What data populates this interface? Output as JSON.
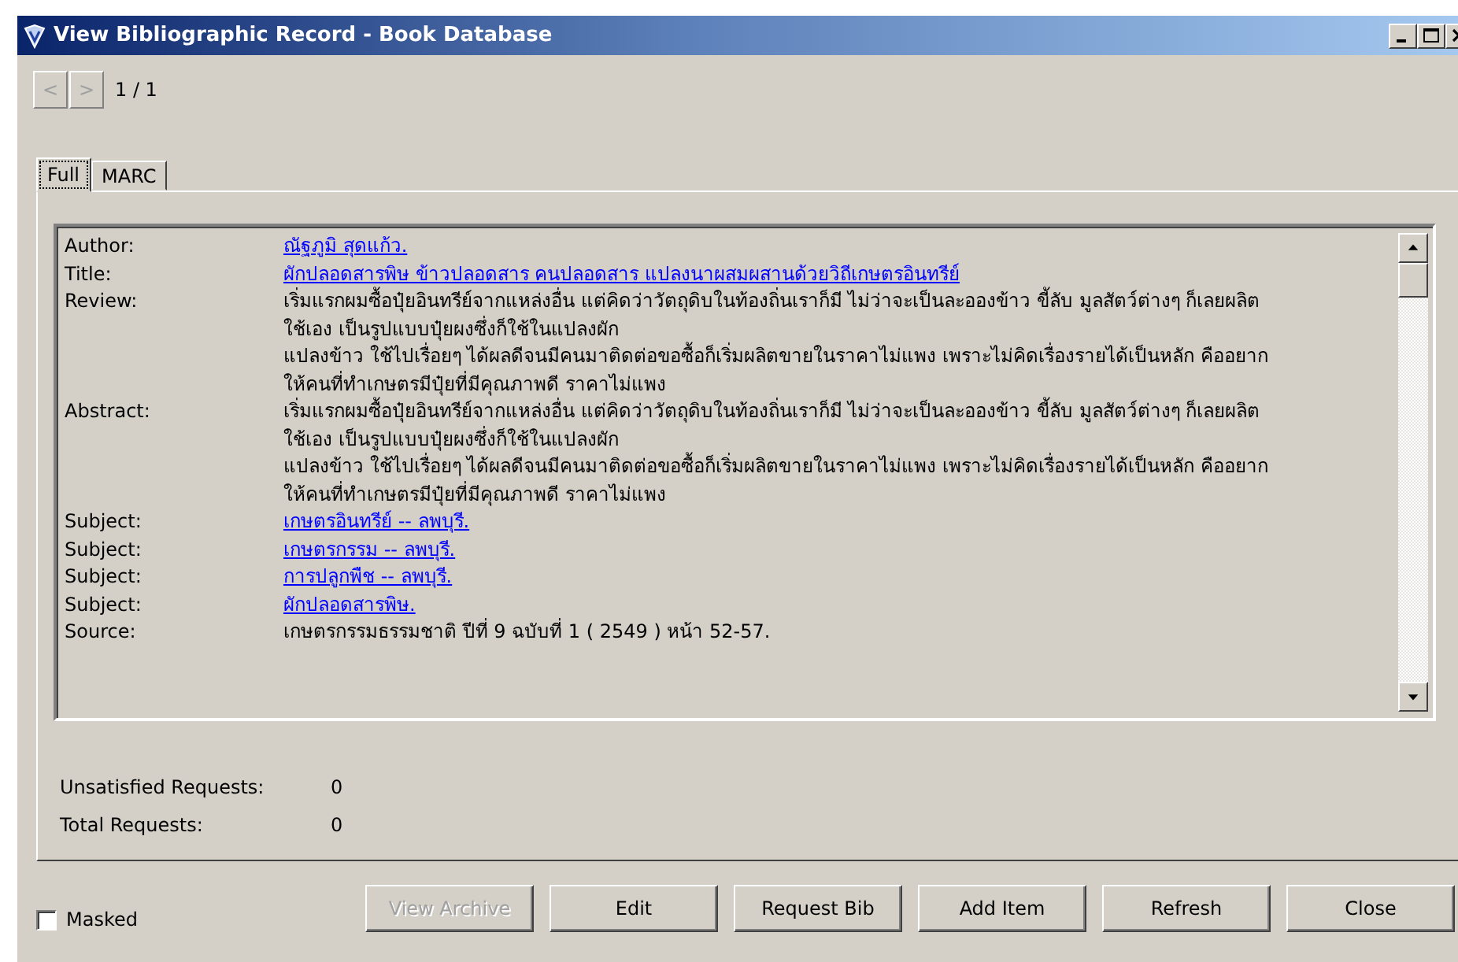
{
  "window": {
    "title": "View Bibliographic Record - Book Database"
  },
  "navigation": {
    "previous": "<",
    "next": ">",
    "position": "1 / 1"
  },
  "tabs": [
    {
      "label": "Full",
      "selected": true
    },
    {
      "label": "MARC",
      "selected": false
    }
  ],
  "record": [
    {
      "label": "Author:",
      "kind": "link",
      "lines": [
        "ณัฐภูมิ สุดแก้ว."
      ]
    },
    {
      "label": "Title:",
      "kind": "link",
      "lines": [
        "ผักปลอดสารพิษ ข้าวปลอดสาร คนปลอดสาร แปลงนาผสมผสานด้วยวิถีเกษตรอินทรีย์"
      ]
    },
    {
      "label": "Review:",
      "kind": "text",
      "lines": [
        "เริ่มแรกผมซื้อปุ๋ยอินทรีย์จากแหล่งอื่น แต่คิดว่าวัตถุดิบในท้องถิ่นเราก็มี ไม่ว่าจะเป็นละอองข้าว ขี้ลับ มูลสัตว์ต่างๆ ก็เลยผลิต",
        "ใช้เอง เป็นรูปแบบปุ๋ยผงซึ่งก็ใช้ในแปลงผัก",
        "แปลงข้าว ใช้ไปเรื่อยๆ ได้ผลดีจนมีคนมาติดต่อขอซื้อก็เริ่มผลิตขายในราคาไม่แพง เพราะไม่คิดเรื่องรายได้เป็นหลัก คืออยาก",
        "ให้คนที่ทำเกษตรมีปุ๋ยที่มีคุณภาพดี ราคาไม่แพง"
      ]
    },
    {
      "label": "Abstract:",
      "kind": "text",
      "lines": [
        "เริ่มแรกผมซื้อปุ๋ยอินทรีย์จากแหล่งอื่น แต่คิดว่าวัตถุดิบในท้องถิ่นเราก็มี ไม่ว่าจะเป็นละอองข้าว ขี้ลับ มูลสัตว์ต่างๆ ก็เลยผลิต",
        "ใช้เอง เป็นรูปแบบปุ๋ยผงซึ่งก็ใช้ในแปลงผัก",
        "แปลงข้าว ใช้ไปเรื่อยๆ ได้ผลดีจนมีคนมาติดต่อขอซื้อก็เริ่มผลิตขายในราคาไม่แพง เพราะไม่คิดเรื่องรายได้เป็นหลัก คืออยาก",
        "ให้คนที่ทำเกษตรมีปุ๋ยที่มีคุณภาพดี ราคาไม่แพง"
      ]
    },
    {
      "label": "Subject:",
      "kind": "link",
      "lines": [
        "เกษตรอินทรีย์ -- ลพบุรี."
      ]
    },
    {
      "label": "Subject:",
      "kind": "link",
      "lines": [
        "เกษตรกรรม -- ลพบุรี."
      ]
    },
    {
      "label": "Subject:",
      "kind": "link",
      "lines": [
        "การปลูกพืช -- ลพบุรี."
      ]
    },
    {
      "label": "Subject:",
      "kind": "link",
      "lines": [
        "ผักปลอดสารพิษ."
      ]
    },
    {
      "label": "Source:",
      "kind": "text",
      "lines": [
        "เกษตรกรรมธรรมชาติ ปีที่ 9 ฉบับที่ 1 ( 2549 ) หน้า 52-57."
      ]
    }
  ],
  "requests": [
    {
      "label": "Unsatisfied Requests:",
      "value": "0"
    },
    {
      "label": "Total Requests:",
      "value": "0"
    }
  ],
  "masked": {
    "label": "Masked",
    "checked": false
  },
  "buttons": [
    {
      "label": "View Archive",
      "disabled": true
    },
    {
      "label": "Edit",
      "disabled": false
    },
    {
      "label": "Request Bib",
      "disabled": false
    },
    {
      "label": "Add Item",
      "disabled": false
    },
    {
      "label": "Refresh",
      "disabled": false
    },
    {
      "label": "Close",
      "disabled": false
    }
  ]
}
